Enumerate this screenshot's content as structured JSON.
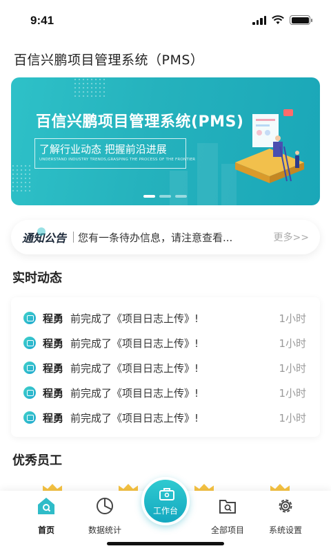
{
  "status": {
    "time": "9:41"
  },
  "app": {
    "title": "百信兴鹏项目管理系统（PMS）"
  },
  "banner": {
    "heading": "百信兴鹏项目管理系统(PMS)",
    "subtitle": "了解行业动态  把握前沿进展",
    "subtitle_en": "UNDERSTAND INDUSTRY TRENDS,GRASPING THE PROCESS OF THE FRONTIER",
    "slide_count": 3,
    "active_slide": 1
  },
  "notice": {
    "tag": "通知公告",
    "text": "您有一条待办信息，请注意查看...",
    "more": "更多>>"
  },
  "sections": {
    "realtime": "实时动态",
    "employees": "优秀员工"
  },
  "feed": [
    {
      "name": "程勇",
      "action": "前完成了《项目日志上传》!",
      "time": "1小时"
    },
    {
      "name": "程勇",
      "action": "前完成了《项目日志上传》!",
      "time": "1小时"
    },
    {
      "name": "程勇",
      "action": "前完成了《项目日志上传》!",
      "time": "1小时"
    },
    {
      "name": "程勇",
      "action": "前完成了《项目日志上传》!",
      "time": "1小时"
    },
    {
      "name": "程勇",
      "action": "前完成了《项目日志上传》!",
      "time": "1小时"
    }
  ],
  "tabs": {
    "home": "首页",
    "stats": "数据统计",
    "workbench": "工作台",
    "projects": "全部项目",
    "settings": "系统设置"
  },
  "colors": {
    "accent": "#25b2bd",
    "crown": "#f5c242"
  }
}
